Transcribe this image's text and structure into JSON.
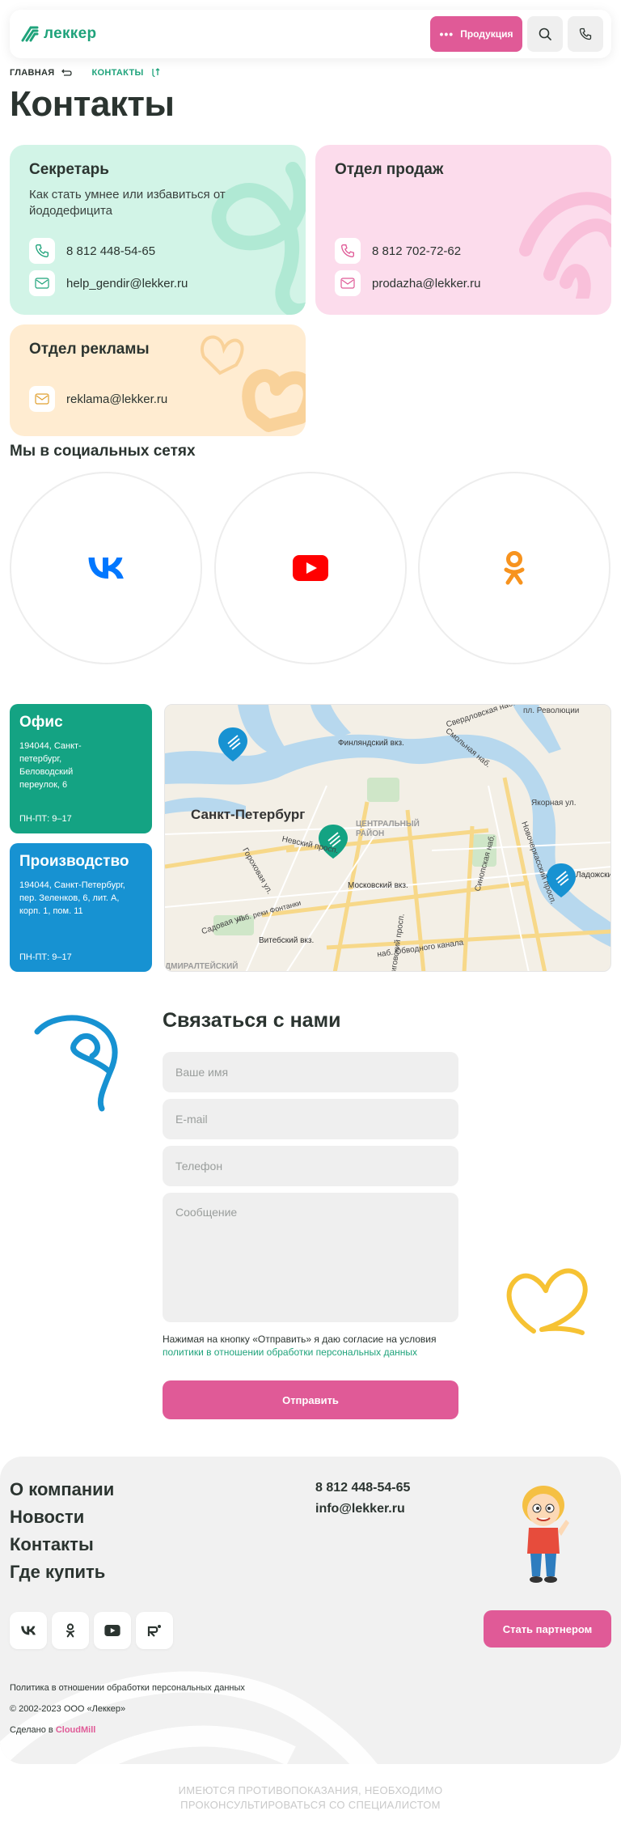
{
  "header": {
    "logo_text": "леккер",
    "products_label": "Продукция",
    "search_icon": "search-icon",
    "phone_icon": "phone-icon"
  },
  "breadcrumb": {
    "home": "ГЛАВНАЯ",
    "current": "КОНТАКТЫ"
  },
  "page_title": "Контакты",
  "cards": {
    "secretary": {
      "title": "Секретарь",
      "subtitle": "Как стать умнее или избавиться от йододефицита",
      "phone": "8 812 448-54-65",
      "email": "help_gendir@lekker.ru"
    },
    "sales": {
      "title": "Отдел продаж",
      "phone": "8 812 702-72-62",
      "email": "prodazha@lekker.ru"
    },
    "ads": {
      "title": "Отдел рекламы",
      "email": "reklama@lekker.ru"
    }
  },
  "social": {
    "title": "Мы в социальных сетях",
    "items": [
      "vk-icon",
      "youtube-icon",
      "odnoklassniki-icon"
    ]
  },
  "locations": {
    "office": {
      "title": "Офис",
      "address": "194044, Санкт-петербург, Беловодский переулок, 6",
      "hours": "ПН-ПТ: 9–17"
    },
    "production": {
      "title": "Производство",
      "address": "194044, Санкт-Петербург, пер. Зеленков, 6, лит. А, корп. 1, пом. 11",
      "hours": "ПН-ПТ: 9–17"
    }
  },
  "map": {
    "city": "Санкт-Петербург",
    "labels": [
      "Свердловская наб.",
      "пл. Революции",
      "Смольная наб.",
      "Финляндский вкз.",
      "Якорная ул.",
      "ЦЕНТРАЛЬНЫЙ РАЙОН",
      "Невский просп.",
      "Московский вкз.",
      "Садовая ул.",
      "Витебский вкз.",
      "наб. Обводного канала",
      "Гороховая ул.",
      "наб. реки Фонтанки",
      "Синопская наб.",
      "Новочеркасский просп.",
      "Ладожски",
      "ДМИРАЛТЕЙСКИЙ",
      "Лиговский просп."
    ]
  },
  "form": {
    "title": "Связаться с нами",
    "name_placeholder": "Ваше имя",
    "email_placeholder": "E-mail",
    "phone_placeholder": "Телефон",
    "message_placeholder": "Сообщение",
    "consent_text": "Нажимая на кнопку «Отправить» я даю согласие на условия",
    "consent_link": "политики в отношении обработки персональных данных",
    "submit_label": "Отправить"
  },
  "footer": {
    "nav": [
      "О компании",
      "Новости",
      "Контакты",
      "Где купить"
    ],
    "phone": "8 812 448-54-65",
    "email": "info@lekker.ru",
    "social_icons": [
      "vk-icon",
      "odnoklassniki-icon",
      "youtube-icon",
      "rutube-icon"
    ],
    "partner_label": "Стать партнером",
    "policy": "Политика в отношении обработки персональных данных",
    "copyright": "© 2002-2023 ООО «Леккер»",
    "made_prefix": "Сделано в ",
    "made_link": "CloudMill"
  },
  "warning": [
    "ИМЕЮТСЯ ПРОТИВОПОКАЗАНИЯ, НЕОБХОДИМО",
    "ПРОКОНСУЛЬТИРОВАТЬСЯ СО СПЕЦИАЛИСТОМ"
  ],
  "colors": {
    "brand_green": "#1fa37b",
    "accent_pink": "#e05a97",
    "office_green": "#14a383",
    "production_blue": "#1792d2"
  }
}
